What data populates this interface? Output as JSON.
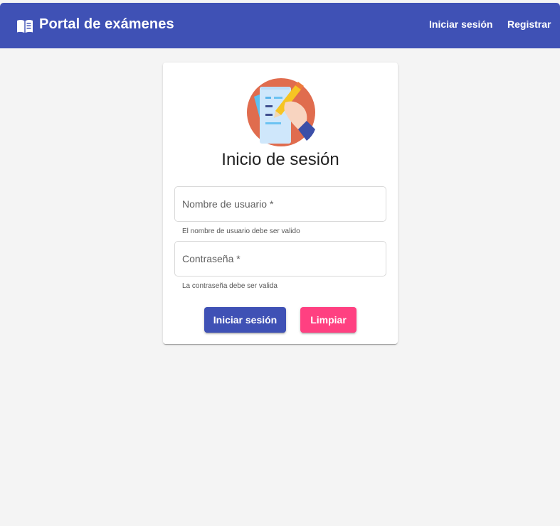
{
  "header": {
    "title": "Portal de exámenes",
    "brand_icon": "book-icon",
    "nav": {
      "login": "Iniciar sesión",
      "register": "Registrar"
    }
  },
  "login_card": {
    "logo_icon": "exam-writing-illustration",
    "title": "Inicio de sesión",
    "username": {
      "placeholder": "Nombre de usuario *",
      "value": "",
      "hint": "El nombre de usuario debe ser valido"
    },
    "password": {
      "placeholder": "Contraseña *",
      "value": "",
      "hint": "La contraseña debe ser valida"
    },
    "buttons": {
      "login": "Iniciar sesión",
      "clear": "Limpiar"
    }
  },
  "colors": {
    "primary": "#3f51b5",
    "accent": "#ff4081",
    "background": "#f4f4f4"
  }
}
